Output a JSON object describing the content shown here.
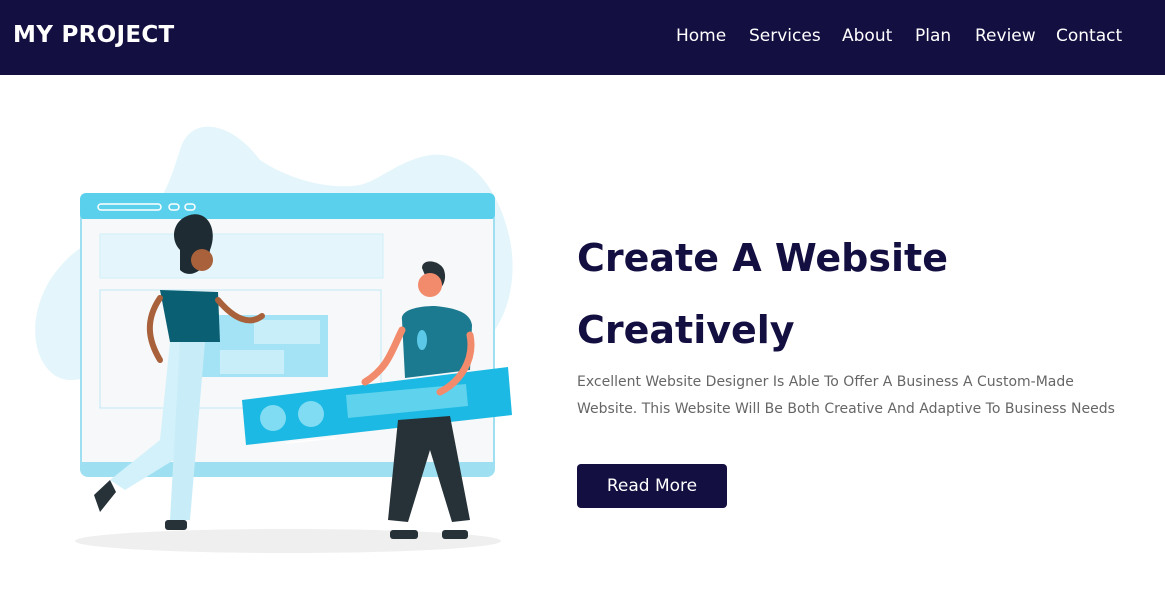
{
  "brand": {
    "logo_text": "MY PROJECT"
  },
  "nav": {
    "items": [
      {
        "label": "Home"
      },
      {
        "label": "Services"
      },
      {
        "label": "About"
      },
      {
        "label": "Plan"
      },
      {
        "label": "Review"
      },
      {
        "label": "Contact"
      }
    ]
  },
  "hero": {
    "title_line1": "Create A Website",
    "title_line2": "Creatively",
    "description": "Excellent Website Designer Is Able To Offer A Business A Custom-Made Website. This Website Will Be Both Creative And Adaptive To Business Needs",
    "cta_label": "Read More",
    "illustration": "website-builders-illustration"
  },
  "colors": {
    "navbar_bg": "#130f40",
    "accent": "#130f40",
    "illustration_blue": "#5bc8e8"
  }
}
